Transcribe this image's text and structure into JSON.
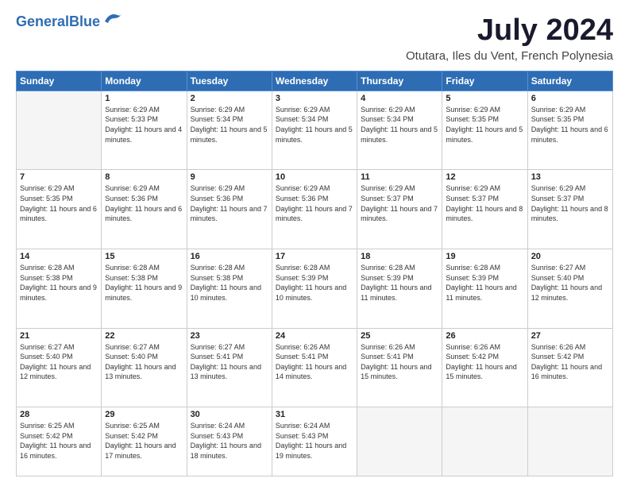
{
  "logo": {
    "line1": "General",
    "line2": "Blue"
  },
  "title": "July 2024",
  "subtitle": "Otutara, Iles du Vent, French Polynesia",
  "days_header": [
    "Sunday",
    "Monday",
    "Tuesday",
    "Wednesday",
    "Thursday",
    "Friday",
    "Saturday"
  ],
  "weeks": [
    [
      {
        "num": "",
        "sunrise": "",
        "sunset": "",
        "daylight": ""
      },
      {
        "num": "1",
        "sunrise": "Sunrise: 6:29 AM",
        "sunset": "Sunset: 5:33 PM",
        "daylight": "Daylight: 11 hours and 4 minutes."
      },
      {
        "num": "2",
        "sunrise": "Sunrise: 6:29 AM",
        "sunset": "Sunset: 5:34 PM",
        "daylight": "Daylight: 11 hours and 5 minutes."
      },
      {
        "num": "3",
        "sunrise": "Sunrise: 6:29 AM",
        "sunset": "Sunset: 5:34 PM",
        "daylight": "Daylight: 11 hours and 5 minutes."
      },
      {
        "num": "4",
        "sunrise": "Sunrise: 6:29 AM",
        "sunset": "Sunset: 5:34 PM",
        "daylight": "Daylight: 11 hours and 5 minutes."
      },
      {
        "num": "5",
        "sunrise": "Sunrise: 6:29 AM",
        "sunset": "Sunset: 5:35 PM",
        "daylight": "Daylight: 11 hours and 5 minutes."
      },
      {
        "num": "6",
        "sunrise": "Sunrise: 6:29 AM",
        "sunset": "Sunset: 5:35 PM",
        "daylight": "Daylight: 11 hours and 6 minutes."
      }
    ],
    [
      {
        "num": "7",
        "sunrise": "Sunrise: 6:29 AM",
        "sunset": "Sunset: 5:35 PM",
        "daylight": "Daylight: 11 hours and 6 minutes."
      },
      {
        "num": "8",
        "sunrise": "Sunrise: 6:29 AM",
        "sunset": "Sunset: 5:36 PM",
        "daylight": "Daylight: 11 hours and 6 minutes."
      },
      {
        "num": "9",
        "sunrise": "Sunrise: 6:29 AM",
        "sunset": "Sunset: 5:36 PM",
        "daylight": "Daylight: 11 hours and 7 minutes."
      },
      {
        "num": "10",
        "sunrise": "Sunrise: 6:29 AM",
        "sunset": "Sunset: 5:36 PM",
        "daylight": "Daylight: 11 hours and 7 minutes."
      },
      {
        "num": "11",
        "sunrise": "Sunrise: 6:29 AM",
        "sunset": "Sunset: 5:37 PM",
        "daylight": "Daylight: 11 hours and 7 minutes."
      },
      {
        "num": "12",
        "sunrise": "Sunrise: 6:29 AM",
        "sunset": "Sunset: 5:37 PM",
        "daylight": "Daylight: 11 hours and 8 minutes."
      },
      {
        "num": "13",
        "sunrise": "Sunrise: 6:29 AM",
        "sunset": "Sunset: 5:37 PM",
        "daylight": "Daylight: 11 hours and 8 minutes."
      }
    ],
    [
      {
        "num": "14",
        "sunrise": "Sunrise: 6:28 AM",
        "sunset": "Sunset: 5:38 PM",
        "daylight": "Daylight: 11 hours and 9 minutes."
      },
      {
        "num": "15",
        "sunrise": "Sunrise: 6:28 AM",
        "sunset": "Sunset: 5:38 PM",
        "daylight": "Daylight: 11 hours and 9 minutes."
      },
      {
        "num": "16",
        "sunrise": "Sunrise: 6:28 AM",
        "sunset": "Sunset: 5:38 PM",
        "daylight": "Daylight: 11 hours and 10 minutes."
      },
      {
        "num": "17",
        "sunrise": "Sunrise: 6:28 AM",
        "sunset": "Sunset: 5:39 PM",
        "daylight": "Daylight: 11 hours and 10 minutes."
      },
      {
        "num": "18",
        "sunrise": "Sunrise: 6:28 AM",
        "sunset": "Sunset: 5:39 PM",
        "daylight": "Daylight: 11 hours and 11 minutes."
      },
      {
        "num": "19",
        "sunrise": "Sunrise: 6:28 AM",
        "sunset": "Sunset: 5:39 PM",
        "daylight": "Daylight: 11 hours and 11 minutes."
      },
      {
        "num": "20",
        "sunrise": "Sunrise: 6:27 AM",
        "sunset": "Sunset: 5:40 PM",
        "daylight": "Daylight: 11 hours and 12 minutes."
      }
    ],
    [
      {
        "num": "21",
        "sunrise": "Sunrise: 6:27 AM",
        "sunset": "Sunset: 5:40 PM",
        "daylight": "Daylight: 11 hours and 12 minutes."
      },
      {
        "num": "22",
        "sunrise": "Sunrise: 6:27 AM",
        "sunset": "Sunset: 5:40 PM",
        "daylight": "Daylight: 11 hours and 13 minutes."
      },
      {
        "num": "23",
        "sunrise": "Sunrise: 6:27 AM",
        "sunset": "Sunset: 5:41 PM",
        "daylight": "Daylight: 11 hours and 13 minutes."
      },
      {
        "num": "24",
        "sunrise": "Sunrise: 6:26 AM",
        "sunset": "Sunset: 5:41 PM",
        "daylight": "Daylight: 11 hours and 14 minutes."
      },
      {
        "num": "25",
        "sunrise": "Sunrise: 6:26 AM",
        "sunset": "Sunset: 5:41 PM",
        "daylight": "Daylight: 11 hours and 15 minutes."
      },
      {
        "num": "26",
        "sunrise": "Sunrise: 6:26 AM",
        "sunset": "Sunset: 5:42 PM",
        "daylight": "Daylight: 11 hours and 15 minutes."
      },
      {
        "num": "27",
        "sunrise": "Sunrise: 6:26 AM",
        "sunset": "Sunset: 5:42 PM",
        "daylight": "Daylight: 11 hours and 16 minutes."
      }
    ],
    [
      {
        "num": "28",
        "sunrise": "Sunrise: 6:25 AM",
        "sunset": "Sunset: 5:42 PM",
        "daylight": "Daylight: 11 hours and 16 minutes."
      },
      {
        "num": "29",
        "sunrise": "Sunrise: 6:25 AM",
        "sunset": "Sunset: 5:42 PM",
        "daylight": "Daylight: 11 hours and 17 minutes."
      },
      {
        "num": "30",
        "sunrise": "Sunrise: 6:24 AM",
        "sunset": "Sunset: 5:43 PM",
        "daylight": "Daylight: 11 hours and 18 minutes."
      },
      {
        "num": "31",
        "sunrise": "Sunrise: 6:24 AM",
        "sunset": "Sunset: 5:43 PM",
        "daylight": "Daylight: 11 hours and 19 minutes."
      },
      {
        "num": "",
        "sunrise": "",
        "sunset": "",
        "daylight": ""
      },
      {
        "num": "",
        "sunrise": "",
        "sunset": "",
        "daylight": ""
      },
      {
        "num": "",
        "sunrise": "",
        "sunset": "",
        "daylight": ""
      }
    ]
  ]
}
